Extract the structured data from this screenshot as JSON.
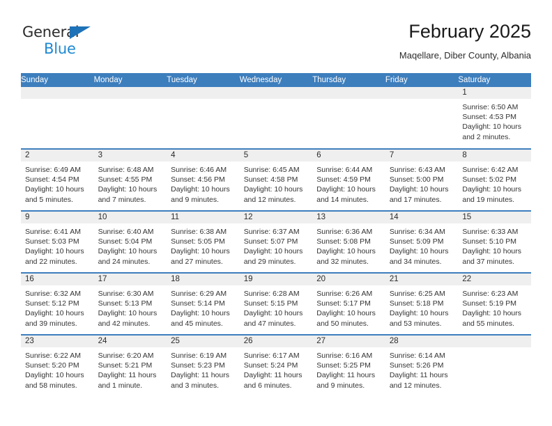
{
  "brand": {
    "line1": "General",
    "line2": "Blue",
    "triangle_color": "#1e72b8",
    "blue_text_color": "#1e88d2"
  },
  "header": {
    "title": "February 2025",
    "subtitle": "Maqellare, Diber County, Albania",
    "accent_color": "#3d7ebd",
    "daynum_band_color": "#efefef"
  },
  "weekdays": [
    "Sunday",
    "Monday",
    "Tuesday",
    "Wednesday",
    "Thursday",
    "Friday",
    "Saturday"
  ],
  "labels": {
    "sunrise_prefix": "Sunrise:",
    "sunset_prefix": "Sunset:",
    "daylight_prefix": "Daylight:"
  },
  "weeks": [
    [
      {
        "empty": true
      },
      {
        "empty": true
      },
      {
        "empty": true
      },
      {
        "empty": true
      },
      {
        "empty": true
      },
      {
        "empty": true
      },
      {
        "day": "1",
        "sunrise": "Sunrise: 6:50 AM",
        "sunset": "Sunset: 4:53 PM",
        "daylight": "Daylight: 10 hours and 2 minutes."
      }
    ],
    [
      {
        "day": "2",
        "sunrise": "Sunrise: 6:49 AM",
        "sunset": "Sunset: 4:54 PM",
        "daylight": "Daylight: 10 hours and 5 minutes."
      },
      {
        "day": "3",
        "sunrise": "Sunrise: 6:48 AM",
        "sunset": "Sunset: 4:55 PM",
        "daylight": "Daylight: 10 hours and 7 minutes."
      },
      {
        "day": "4",
        "sunrise": "Sunrise: 6:46 AM",
        "sunset": "Sunset: 4:56 PM",
        "daylight": "Daylight: 10 hours and 9 minutes."
      },
      {
        "day": "5",
        "sunrise": "Sunrise: 6:45 AM",
        "sunset": "Sunset: 4:58 PM",
        "daylight": "Daylight: 10 hours and 12 minutes."
      },
      {
        "day": "6",
        "sunrise": "Sunrise: 6:44 AM",
        "sunset": "Sunset: 4:59 PM",
        "daylight": "Daylight: 10 hours and 14 minutes."
      },
      {
        "day": "7",
        "sunrise": "Sunrise: 6:43 AM",
        "sunset": "Sunset: 5:00 PM",
        "daylight": "Daylight: 10 hours and 17 minutes."
      },
      {
        "day": "8",
        "sunrise": "Sunrise: 6:42 AM",
        "sunset": "Sunset: 5:02 PM",
        "daylight": "Daylight: 10 hours and 19 minutes."
      }
    ],
    [
      {
        "day": "9",
        "sunrise": "Sunrise: 6:41 AM",
        "sunset": "Sunset: 5:03 PM",
        "daylight": "Daylight: 10 hours and 22 minutes."
      },
      {
        "day": "10",
        "sunrise": "Sunrise: 6:40 AM",
        "sunset": "Sunset: 5:04 PM",
        "daylight": "Daylight: 10 hours and 24 minutes."
      },
      {
        "day": "11",
        "sunrise": "Sunrise: 6:38 AM",
        "sunset": "Sunset: 5:05 PM",
        "daylight": "Daylight: 10 hours and 27 minutes."
      },
      {
        "day": "12",
        "sunrise": "Sunrise: 6:37 AM",
        "sunset": "Sunset: 5:07 PM",
        "daylight": "Daylight: 10 hours and 29 minutes."
      },
      {
        "day": "13",
        "sunrise": "Sunrise: 6:36 AM",
        "sunset": "Sunset: 5:08 PM",
        "daylight": "Daylight: 10 hours and 32 minutes."
      },
      {
        "day": "14",
        "sunrise": "Sunrise: 6:34 AM",
        "sunset": "Sunset: 5:09 PM",
        "daylight": "Daylight: 10 hours and 34 minutes."
      },
      {
        "day": "15",
        "sunrise": "Sunrise: 6:33 AM",
        "sunset": "Sunset: 5:10 PM",
        "daylight": "Daylight: 10 hours and 37 minutes."
      }
    ],
    [
      {
        "day": "16",
        "sunrise": "Sunrise: 6:32 AM",
        "sunset": "Sunset: 5:12 PM",
        "daylight": "Daylight: 10 hours and 39 minutes."
      },
      {
        "day": "17",
        "sunrise": "Sunrise: 6:30 AM",
        "sunset": "Sunset: 5:13 PM",
        "daylight": "Daylight: 10 hours and 42 minutes."
      },
      {
        "day": "18",
        "sunrise": "Sunrise: 6:29 AM",
        "sunset": "Sunset: 5:14 PM",
        "daylight": "Daylight: 10 hours and 45 minutes."
      },
      {
        "day": "19",
        "sunrise": "Sunrise: 6:28 AM",
        "sunset": "Sunset: 5:15 PM",
        "daylight": "Daylight: 10 hours and 47 minutes."
      },
      {
        "day": "20",
        "sunrise": "Sunrise: 6:26 AM",
        "sunset": "Sunset: 5:17 PM",
        "daylight": "Daylight: 10 hours and 50 minutes."
      },
      {
        "day": "21",
        "sunrise": "Sunrise: 6:25 AM",
        "sunset": "Sunset: 5:18 PM",
        "daylight": "Daylight: 10 hours and 53 minutes."
      },
      {
        "day": "22",
        "sunrise": "Sunrise: 6:23 AM",
        "sunset": "Sunset: 5:19 PM",
        "daylight": "Daylight: 10 hours and 55 minutes."
      }
    ],
    [
      {
        "day": "23",
        "sunrise": "Sunrise: 6:22 AM",
        "sunset": "Sunset: 5:20 PM",
        "daylight": "Daylight: 10 hours and 58 minutes."
      },
      {
        "day": "24",
        "sunrise": "Sunrise: 6:20 AM",
        "sunset": "Sunset: 5:21 PM",
        "daylight": "Daylight: 11 hours and 1 minute."
      },
      {
        "day": "25",
        "sunrise": "Sunrise: 6:19 AM",
        "sunset": "Sunset: 5:23 PM",
        "daylight": "Daylight: 11 hours and 3 minutes."
      },
      {
        "day": "26",
        "sunrise": "Sunrise: 6:17 AM",
        "sunset": "Sunset: 5:24 PM",
        "daylight": "Daylight: 11 hours and 6 minutes."
      },
      {
        "day": "27",
        "sunrise": "Sunrise: 6:16 AM",
        "sunset": "Sunset: 5:25 PM",
        "daylight": "Daylight: 11 hours and 9 minutes."
      },
      {
        "day": "28",
        "sunrise": "Sunrise: 6:14 AM",
        "sunset": "Sunset: 5:26 PM",
        "daylight": "Daylight: 11 hours and 12 minutes."
      },
      {
        "empty": true
      }
    ]
  ]
}
